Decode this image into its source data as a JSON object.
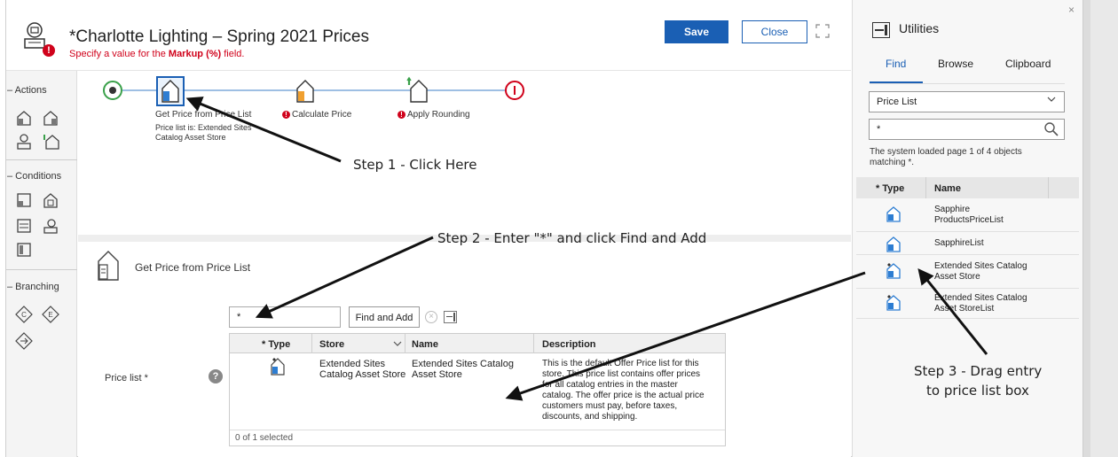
{
  "header": {
    "title": "*Charlotte Lighting – Spring 2021 Prices",
    "error_prefix": "Specify a value for the ",
    "error_field": "Markup (%)",
    "error_suffix": " field.",
    "save_label": "Save",
    "close_label": "Close"
  },
  "palette": {
    "actions": "– Actions",
    "conditions": "– Conditions",
    "branching": "– Branching"
  },
  "flow": {
    "step1_label": "Get Price from Price List",
    "step1_sub1": "Price list is: Extended Sites",
    "step1_sub2": "Catalog Asset Store",
    "step2_label": "Calculate Price",
    "step3_label": "Apply Rounding"
  },
  "props": {
    "title": "Get Price from Price List",
    "price_list_label": "Price list *",
    "search_value": "*",
    "find_add_label": "Find and Add",
    "columns": [
      "* Type",
      "Store",
      "Name",
      "Description"
    ],
    "row": {
      "store": [
        "Extended Sites",
        "Catalog Asset Store"
      ],
      "name": [
        "Extended Sites Catalog",
        "Asset Store"
      ],
      "description": [
        "This is the default Offer Price list for this",
        "store. This price list contains offer prices",
        "for all catalog entries in the master",
        "catalog. The offer price is the actual price",
        "customers must pay, before taxes,",
        "discounts, and shipping."
      ]
    },
    "footer": "0 of 1 selected"
  },
  "utilities": {
    "title": "Utilities",
    "tabs": [
      "Find",
      "Browse",
      "Clipboard"
    ],
    "active_tab": "Find",
    "type_select": "Price List",
    "search_value": "*",
    "status": [
      "The system loaded page 1 of 4 objects",
      "matching *."
    ],
    "columns": [
      "* Type",
      "Name"
    ],
    "results": [
      [
        "Sapphire",
        "ProductsPriceList"
      ],
      [
        "SapphireList"
      ],
      [
        "Extended Sites Catalog",
        "Asset Store"
      ],
      [
        "Extended Sites Catalog",
        "Asset StoreList"
      ]
    ]
  },
  "annotations": {
    "step1": "Step 1 - Click Here",
    "step2": "Step 2 - Enter \"*\" and click Find and Add",
    "step3a": "Step 3 - Drag entry",
    "step3b": "to price list box"
  },
  "colors": {
    "accent": "#1a5fb4",
    "error": "#d0021b",
    "start_node": "#3aa04a"
  }
}
